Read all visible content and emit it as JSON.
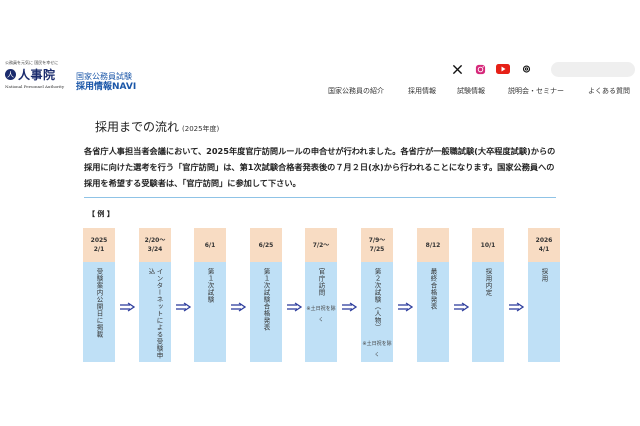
{
  "header": {
    "logo": {
      "tagline": "公務員を元気に 国民を幸せに",
      "mark": "人",
      "name": "人事院",
      "english": "National Personnel Authority"
    },
    "site_title_line1": "国家公務員試験",
    "site_title_line2": "採用情報NAVI",
    "social_icons": [
      "x-icon",
      "instagram-icon",
      "youtube-icon",
      "threads-icon"
    ],
    "search_placeholder": ""
  },
  "nav": [
    "国家公務員の紹介",
    "採用情報",
    "試験情報",
    "説明会・セミナー",
    "よくある質問"
  ],
  "page": {
    "title": "採用までの流れ",
    "title_sub": "(2025年度)",
    "intro": "各省庁人事担当者会議において、2025年度官庁訪問ルールの申合せが行われました。各省庁が一般職試験(大卒程度試験)からの採用に向けた選考を行う「官庁訪問」は、第1次試験合格者発表後の７月２日(水)から行われることになります。国家公務員への採用を希望する受験者は、「官庁訪問」に参加して下さい。",
    "example_label": "【 例 】"
  },
  "steps": [
    {
      "date1": "2025",
      "date2": "2/1",
      "label": "受験案内公開日に掲載",
      "note": ""
    },
    {
      "date1": "2/20〜",
      "date2": "3/24",
      "label": "インターネットによる受験申込",
      "note": ""
    },
    {
      "date1": "6/1",
      "date2": "",
      "label": "第１次試験",
      "note": ""
    },
    {
      "date1": "6/25",
      "date2": "",
      "label": "第１次試験合格発表",
      "note": ""
    },
    {
      "date1": "7/2〜",
      "date2": "",
      "label": "官庁訪問",
      "note": "※土日祝を除く"
    },
    {
      "date1": "7/9〜",
      "date2": "7/25",
      "label": "第２次試験（人物）",
      "note": "※土日祝を除く"
    },
    {
      "date1": "8/12",
      "date2": "",
      "label": "最終合格発表",
      "note": ""
    },
    {
      "date1": "10/1",
      "date2": "",
      "label": "採用内定",
      "note": ""
    },
    {
      "date1": "2026",
      "date2": "4/1",
      "label": "採用",
      "note": ""
    }
  ],
  "colors": {
    "date_bg": "#f8dcc3",
    "body_bg": "#bfe0f6",
    "arrow": "#2f3f9e",
    "accent": "#1a56a8"
  }
}
